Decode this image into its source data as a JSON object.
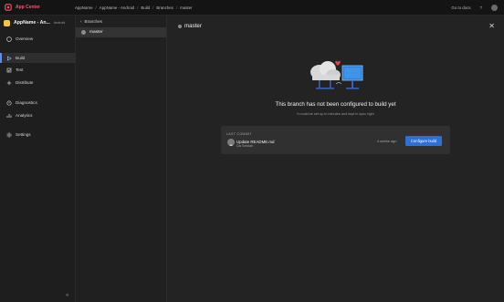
{
  "topbar": {
    "brand": "App Center",
    "breadcrumbs": [
      "AppName",
      "AppName - Android",
      "Build",
      "Branches",
      "master"
    ],
    "help_label": "Go to docs",
    "help_icon": "question-icon"
  },
  "sidebar": {
    "app_name": "AppName - An...",
    "app_badge": "Android",
    "items": [
      {
        "label": "Overview",
        "icon": "overview-icon"
      },
      {
        "label": "Build",
        "icon": "build-icon",
        "active": true
      },
      {
        "label": "Test",
        "icon": "test-icon"
      },
      {
        "label": "Distribute",
        "icon": "distribute-icon"
      },
      {
        "label": "Diagnostics",
        "icon": "diagnostics-icon"
      },
      {
        "label": "Analytics",
        "icon": "analytics-icon"
      },
      {
        "label": "Settings",
        "icon": "settings-icon"
      }
    ],
    "collapse_glyph": "«"
  },
  "branches": {
    "back_glyph": "‹",
    "header": "Branches",
    "items": [
      {
        "name": "master"
      }
    ]
  },
  "main": {
    "title": "master",
    "empty_title": "This branch has not been configured to build yet",
    "empty_subtitle": "It could be set up in minutes and kept in sync right",
    "commit": {
      "label": "LAST COMMIT",
      "message": "Update README.md",
      "author": "Da Seixiah",
      "time": "4 weeks ago"
    },
    "configure_button": "Configure build"
  },
  "colors": {
    "accent": "#2f6fd8",
    "brand": "#f05a6a",
    "app_icon": "#f4c542"
  }
}
